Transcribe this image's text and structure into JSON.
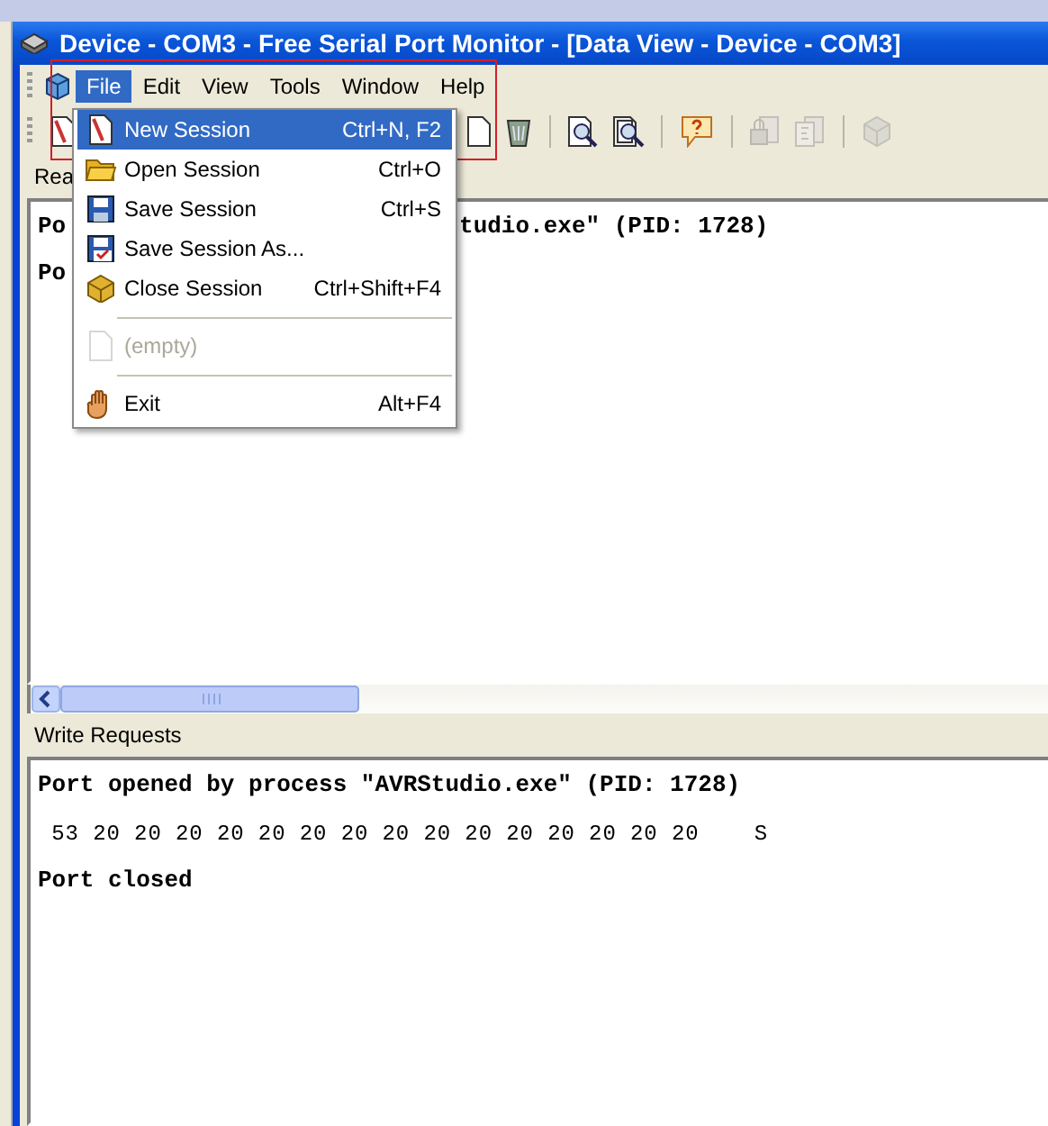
{
  "window": {
    "title": "Device - COM3 - Free Serial Port Monitor - [Data View - Device - COM3]"
  },
  "menu_bar": [
    {
      "label": "File",
      "selected": true
    },
    {
      "label": "Edit",
      "selected": false
    },
    {
      "label": "View",
      "selected": false
    },
    {
      "label": "Tools",
      "selected": false
    },
    {
      "label": "Window",
      "selected": false
    },
    {
      "label": "Help",
      "selected": false
    }
  ],
  "toolbar": [
    {
      "kind": "new",
      "disabled": false
    },
    {
      "kind": "doc",
      "disabled": false
    },
    {
      "kind": "trash",
      "disabled": false
    },
    {
      "kind": "find",
      "disabled": false
    },
    {
      "kind": "find2",
      "disabled": false
    },
    {
      "kind": "help",
      "disabled": false
    },
    {
      "kind": "lock",
      "disabled": true
    },
    {
      "kind": "doc2",
      "disabled": true
    },
    {
      "kind": "cube",
      "disabled": true
    }
  ],
  "file_menu": [
    {
      "kind": "item",
      "label": "New Session",
      "shortcut": "Ctrl+N, F2",
      "selected": true,
      "disabled": false
    },
    {
      "kind": "item",
      "label": "Open Session",
      "shortcut": "Ctrl+O",
      "selected": false,
      "disabled": false
    },
    {
      "kind": "item",
      "label": "Save Session",
      "shortcut": "Ctrl+S",
      "selected": false,
      "disabled": false
    },
    {
      "kind": "item",
      "label": "Save Session As...",
      "selected": false,
      "disabled": false
    },
    {
      "kind": "item",
      "label": "Close Session",
      "shortcut": "Ctrl+Shift+F4",
      "selected": false,
      "disabled": false
    },
    {
      "kind": "separator"
    },
    {
      "kind": "item",
      "label": "(empty)",
      "selected": false,
      "disabled": true
    },
    {
      "kind": "separator"
    },
    {
      "kind": "item",
      "label": "Exit",
      "shortcut": "Alt+F4",
      "selected": false,
      "disabled": false
    }
  ],
  "read_pane": {
    "label": "Rea",
    "lines": [
      {
        "left": "Po",
        "right": "tudio.exe\" (PID: 1728)",
        "kind": "bold"
      },
      {
        "left": "Po",
        "kind": "bold"
      }
    ]
  },
  "write_pane": {
    "label": "Write Requests",
    "lines": [
      {
        "left": "Port opened by process \"AVRStudio.exe\" (PID: 1728)",
        "kind": "bold"
      },
      {
        "left": " 53 20 20 20 20 20 20 20 20 20 20 20 20 20 20 20    S",
        "kind": "hex"
      },
      {
        "left": "Port closed",
        "kind": "bold"
      }
    ]
  }
}
